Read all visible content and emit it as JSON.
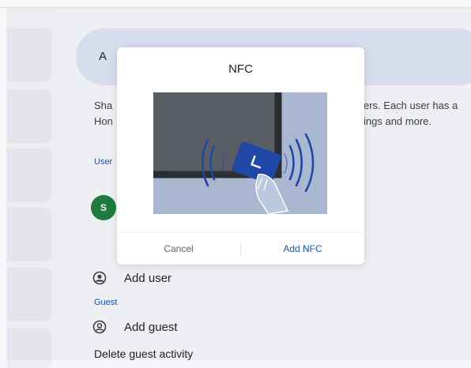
{
  "background": {
    "search_initial": "A",
    "description_left": [
      "Sha",
      "Hon"
    ],
    "description_right": [
      "ers. Each user has a",
      "ings and more."
    ],
    "users_section_label": "User",
    "avatar_initial": "S",
    "add_user_label": "Add user",
    "guest_section_label": "Guest",
    "add_guest_label": "Add guest",
    "delete_guest_label": "Delete guest activity"
  },
  "dialog": {
    "title": "NFC",
    "cancel_label": "Cancel",
    "confirm_label": "Add NFC"
  },
  "colors": {
    "accent": "#1a56c7",
    "avatar": "#1e7e3e",
    "search_pill": "#dde4f5",
    "nfc_card": "#1f48a6"
  },
  "icons": {
    "add_user": "account-circle-icon",
    "add_guest": "guest-account-icon",
    "illustration": "nfc-tap-illustration"
  }
}
